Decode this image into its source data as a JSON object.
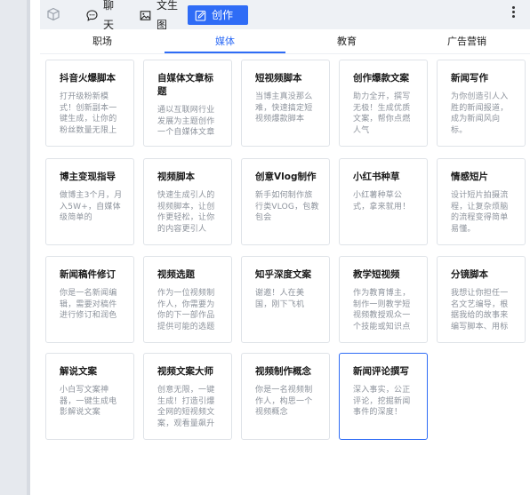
{
  "toolbar": {
    "tabs": [
      {
        "label": "聊天",
        "icon": "chat-icon"
      },
      {
        "label": "文生图",
        "icon": "image-icon"
      },
      {
        "label": "创作",
        "icon": "edit-icon"
      }
    ],
    "accent": "#2f6cf6"
  },
  "categories": [
    "职场",
    "媒体",
    "教育",
    "广告营销"
  ],
  "selected_category": "媒体",
  "cards": [
    {
      "title": "抖音火爆脚本",
      "desc": "打开级粉新模式！创新副本一键生成，让你的粉丝数量无限上"
    },
    {
      "title": "自媒体文章标题",
      "desc": "通以互联网行业发展为主题创作一个自媒体文章"
    },
    {
      "title": "短视频脚本",
      "desc": "当博主真没那么难，快速搞定短视频爆款脚本"
    },
    {
      "title": "创作爆款文案",
      "desc": "助力全开，撰写无极！生成优质文案，帮你点燃人气"
    },
    {
      "title": "新闻写作",
      "desc": "为你创造引人入胜的新闻报道，成为新闻风向标。"
    },
    {
      "title": "博主变现指导",
      "desc": "做博主3个月，月入5W+，自媒体级简单的"
    },
    {
      "title": "视频脚本",
      "desc": "快速生成引人的视频脚本，让创作更轻松，让你的内容更引人"
    },
    {
      "title": "创意Vlog制作",
      "desc": "新手如何制作旅行类VLOG，包教包会"
    },
    {
      "title": "小红书种草",
      "desc": "小红薯种草公式，拿来就用！"
    },
    {
      "title": "情感短片",
      "desc": "设计短片拍摄流程，让复杂烦脑的流程变得简单易懂。"
    },
    {
      "title": "新闻稿件修订",
      "desc": "你是一名新闻编辑，需要对稿件进行修订和润色"
    },
    {
      "title": "视频选题",
      "desc": "作为一位视频制作人，你需要为你的下一部作品提供可能的选题"
    },
    {
      "title": "知乎深度文案",
      "desc": "谢邀！人在美国，刚下飞机"
    },
    {
      "title": "教学短视频",
      "desc": "作为教育博主，制作一则教学短视频教授观众一个技能或知识点"
    },
    {
      "title": "分镜脚本",
      "desc": "我想让你担任一名文艺编导，根据我给的故事来编写脚本、用标"
    },
    {
      "title": "解说文案",
      "desc": "小白写文案神器，一键生成电影解说文案"
    },
    {
      "title": "视频文案大师",
      "desc": "创意无限，一键生成！打造引爆全网的短视频文案，观看量飙升"
    },
    {
      "title": "视频制作概念",
      "desc": "你是一名视频制作人，构思一个视频概念"
    },
    {
      "title": "新闻评论撰写",
      "desc": "深入事实，公正评论，挖掘新闻事件的深度！"
    }
  ],
  "active_card_index": 18
}
